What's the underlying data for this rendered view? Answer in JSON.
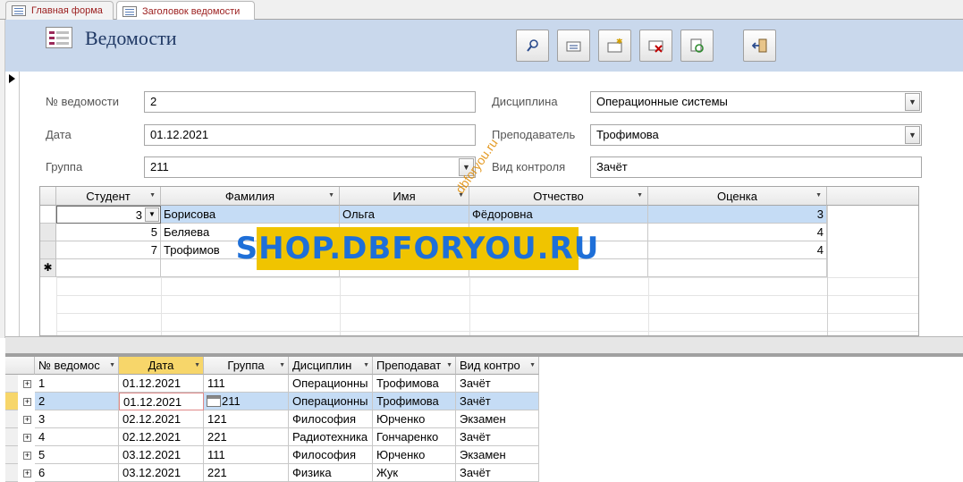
{
  "tabs": [
    {
      "label": "Главная форма"
    },
    {
      "label": "Заголовок ведомости"
    }
  ],
  "header": {
    "title": "Ведомости"
  },
  "toolbar": [
    "search-icon",
    "new-record-icon",
    "add-record-icon",
    "delete-record-icon",
    "refresh-icon",
    "exit-icon"
  ],
  "form": {
    "number_label": "№ ведомости",
    "number_value": "2",
    "date_label": "Дата",
    "date_value": "01.12.2021",
    "group_label": "Группа",
    "group_value": "211",
    "discipline_label": "Дисциплина",
    "discipline_value": "Операционные системы",
    "teacher_label": "Преподаватель",
    "teacher_value": "Трофимова",
    "control_label": "Вид контроля",
    "control_value": "Зачёт"
  },
  "subform": {
    "headers": [
      "Студент",
      "Фамилия",
      "Имя",
      "Отчество",
      "Оценка"
    ],
    "rows": [
      [
        "3",
        "Борисова",
        "Ольга",
        "Фёдоровна",
        "3"
      ],
      [
        "5",
        "Беляева",
        "",
        "",
        "4"
      ],
      [
        "7",
        "Трофимов",
        "",
        "",
        "4"
      ]
    ],
    "new_row_marker": "✱"
  },
  "datasheet": {
    "headers": [
      "№ ведомос",
      "Дата",
      "Группа",
      "Дисциплин",
      "Преподават",
      "Вид контро"
    ],
    "rows": [
      [
        "1",
        "01.12.2021",
        "111",
        "Операционны",
        "Трофимова",
        "Зачёт"
      ],
      [
        "2",
        "01.12.2021",
        "211",
        "Операционны",
        "Трофимова",
        "Зачёт"
      ],
      [
        "3",
        "02.12.2021",
        "121",
        "Философия",
        "Юрченко",
        "Экзамен"
      ],
      [
        "4",
        "02.12.2021",
        "221",
        "Радиотехника",
        "Гончаренко",
        "Зачёт"
      ],
      [
        "5",
        "03.12.2021",
        "111",
        "Философия",
        "Юрченко",
        "Экзамен"
      ],
      [
        "6",
        "03.12.2021",
        "221",
        "Физика",
        "Жук",
        "Зачёт"
      ]
    ]
  },
  "watermark": {
    "text": "SHOP.DBFORYOU.RU",
    "small": "dbforyou.ru"
  }
}
